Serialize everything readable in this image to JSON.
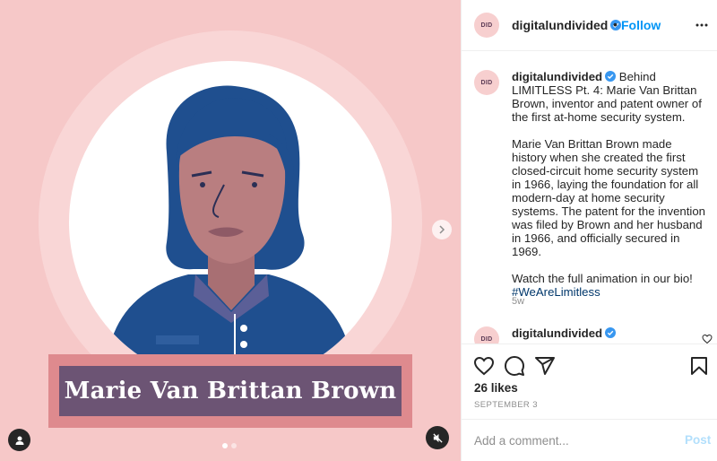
{
  "post": {
    "media": {
      "banner_text": "Marie Van Brittan Brown",
      "colors": {
        "background": "#f6c8c8",
        "banner_outer": "#de8a8e",
        "banner_inner": "#6c5474",
        "hair": "#1f4f8f",
        "skin": "#b97e80"
      },
      "carousel": {
        "count": 2,
        "active": 1
      }
    },
    "header": {
      "avatar_text": "DID",
      "username": "digitalundivided",
      "separator": "•",
      "follow_label": "Follow"
    },
    "caption": {
      "avatar_text": "DID",
      "username": "digitalundivided",
      "text": "Behind LIMITLESS Pt. 4: Marie Van Brittan Brown, inventor and patent owner of the first at-home security system.\n\nMarie Van Brittan Brown made history when she created the first closed-circuit home security system in 1966, laying the foundation for all modern-day at home security systems. The patent for the invention was filed by Brown and her husband in 1966, and officially secured in 1969.\n\nWatch the full animation in our bio! ",
      "hashtag": "#WeAreLimitless",
      "time": "5w"
    },
    "comment2": {
      "avatar_text": "DID",
      "username": "digitalundivided"
    },
    "likes": "26 likes",
    "date": "SEPTEMBER 3",
    "add_comment": {
      "placeholder": "Add a comment...",
      "post_label": "Post"
    },
    "icons": {
      "like": "heart-icon",
      "comment": "comment-icon",
      "share": "share-icon",
      "save": "bookmark-icon",
      "more": "more-icon",
      "verified": "verified-icon",
      "next": "chevron-right-icon",
      "tag": "user-tag-icon",
      "mute": "muted-icon"
    },
    "accent_color": "#0095f6"
  }
}
